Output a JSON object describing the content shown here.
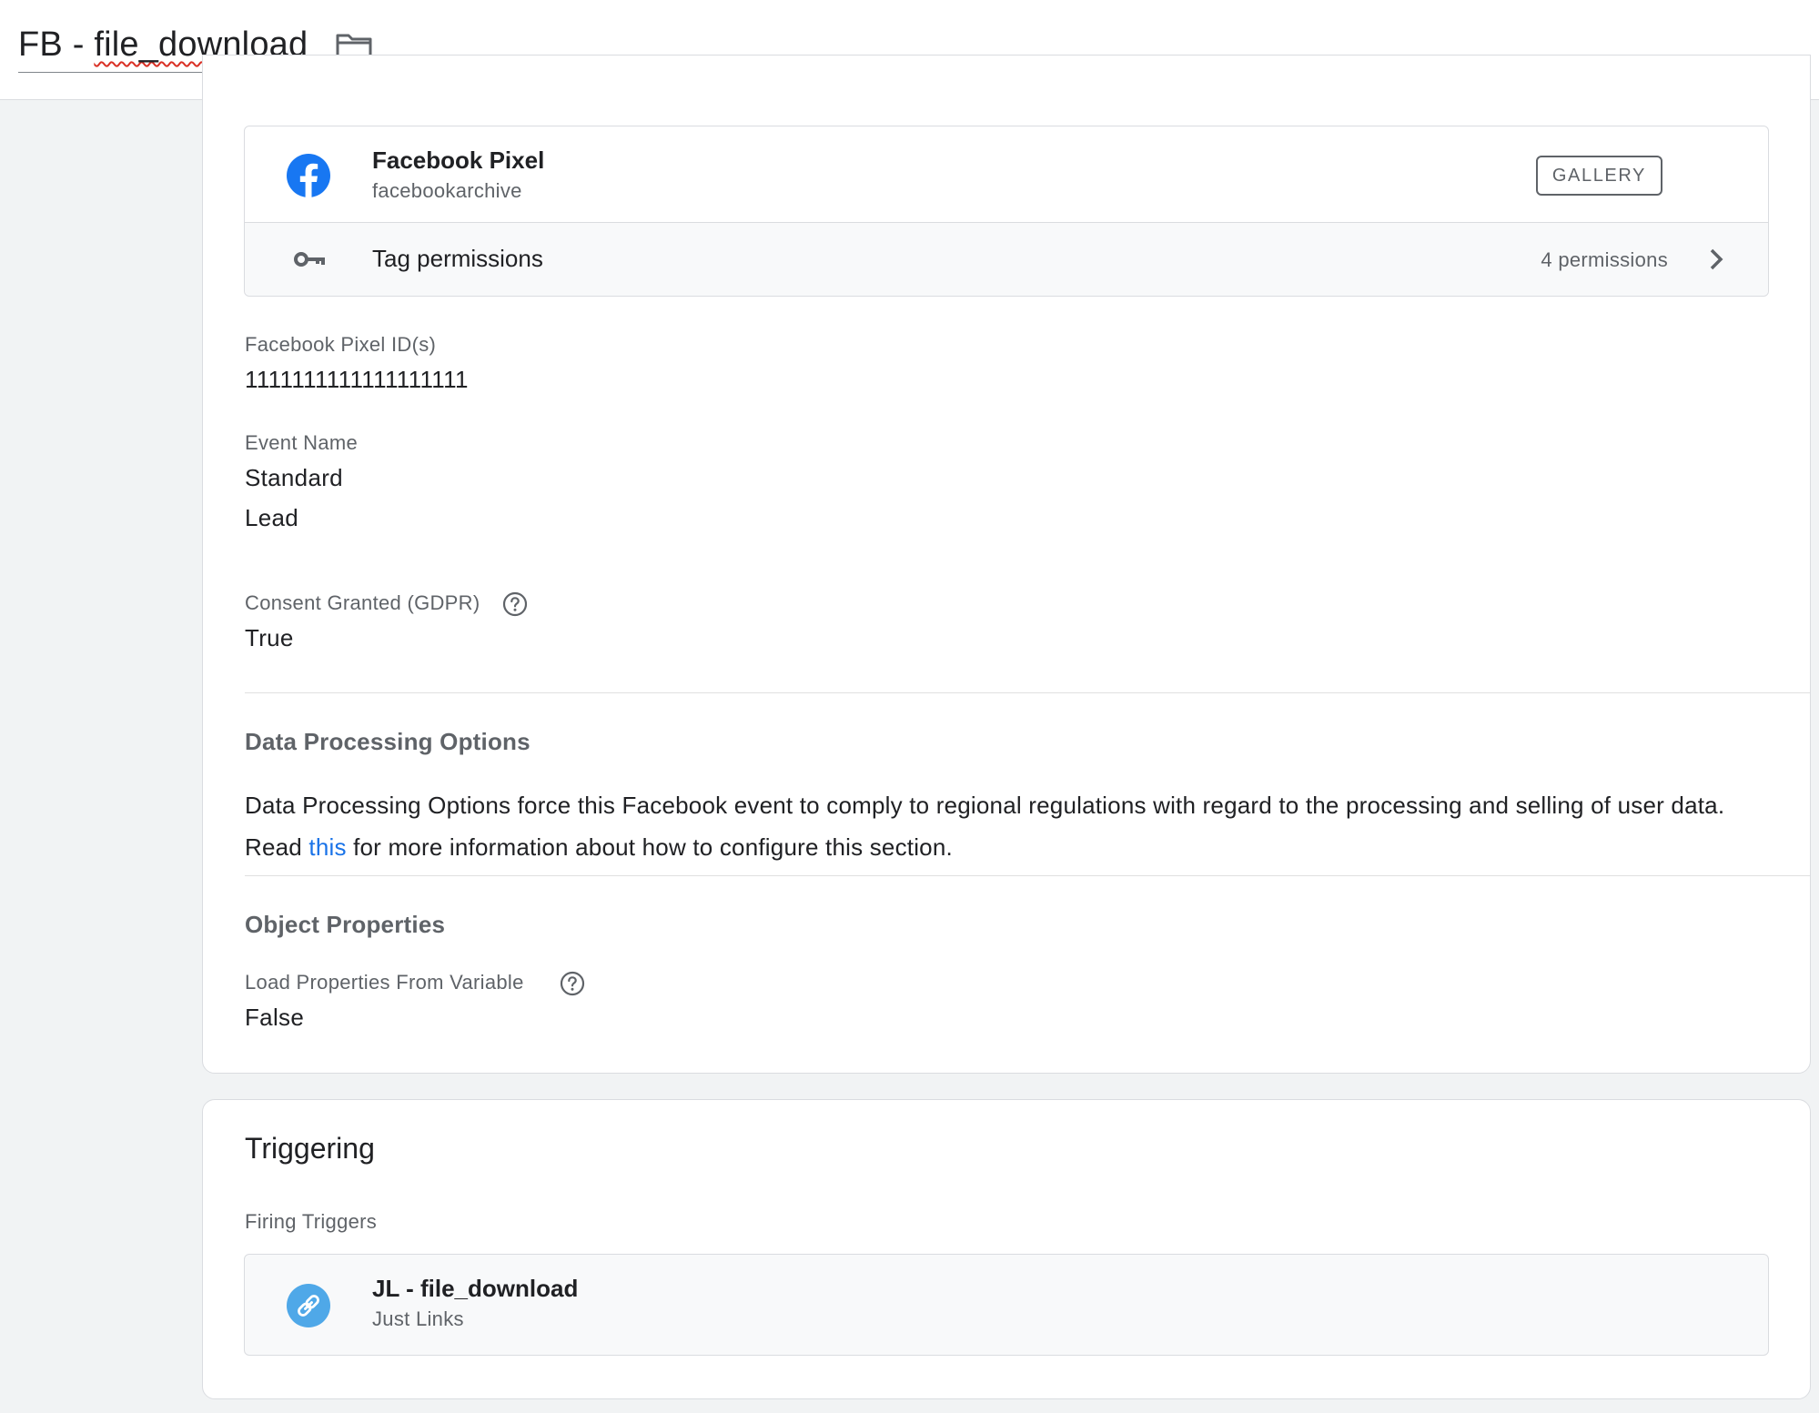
{
  "header": {
    "tag_name_prefix": "FB - ",
    "tag_name_word": "file_download",
    "folder_icon": "folder-icon"
  },
  "tag_type": {
    "icon": "facebook-icon",
    "title": "Facebook Pixel",
    "subtitle": "facebookarchive",
    "gallery_label": "GALLERY",
    "permissions_icon": "key-icon",
    "permissions_label": "Tag permissions",
    "permissions_count": "4 permissions",
    "chevron_icon": "chevron-right-icon"
  },
  "fields": {
    "pixel_id_label": "Facebook Pixel ID(s)",
    "pixel_id_value": "1111111111111111111",
    "event_name_label": "Event Name",
    "event_name_type": "Standard",
    "event_name_value": "Lead",
    "consent_label": "Consent Granted (GDPR)",
    "consent_value": "True"
  },
  "data_processing": {
    "title": "Data Processing Options",
    "text_before": "Data Processing Options force this Facebook event to comply to regional regulations with regard to the processing and selling of user data. Read ",
    "link_text": "this",
    "text_after": " for more information about how to configure this section."
  },
  "object_properties": {
    "title": "Object Properties",
    "load_label": "Load Properties From Variable",
    "load_value": "False"
  },
  "triggering": {
    "title": "Triggering",
    "firing_label": "Firing Triggers",
    "trigger_icon": "link-icon",
    "trigger_name": "JL - file_download",
    "trigger_type": "Just Links"
  },
  "colors": {
    "facebook_blue": "#1877f2",
    "trigger_icon_bg": "#4fa8e8",
    "link_blue": "#1a73e8"
  }
}
